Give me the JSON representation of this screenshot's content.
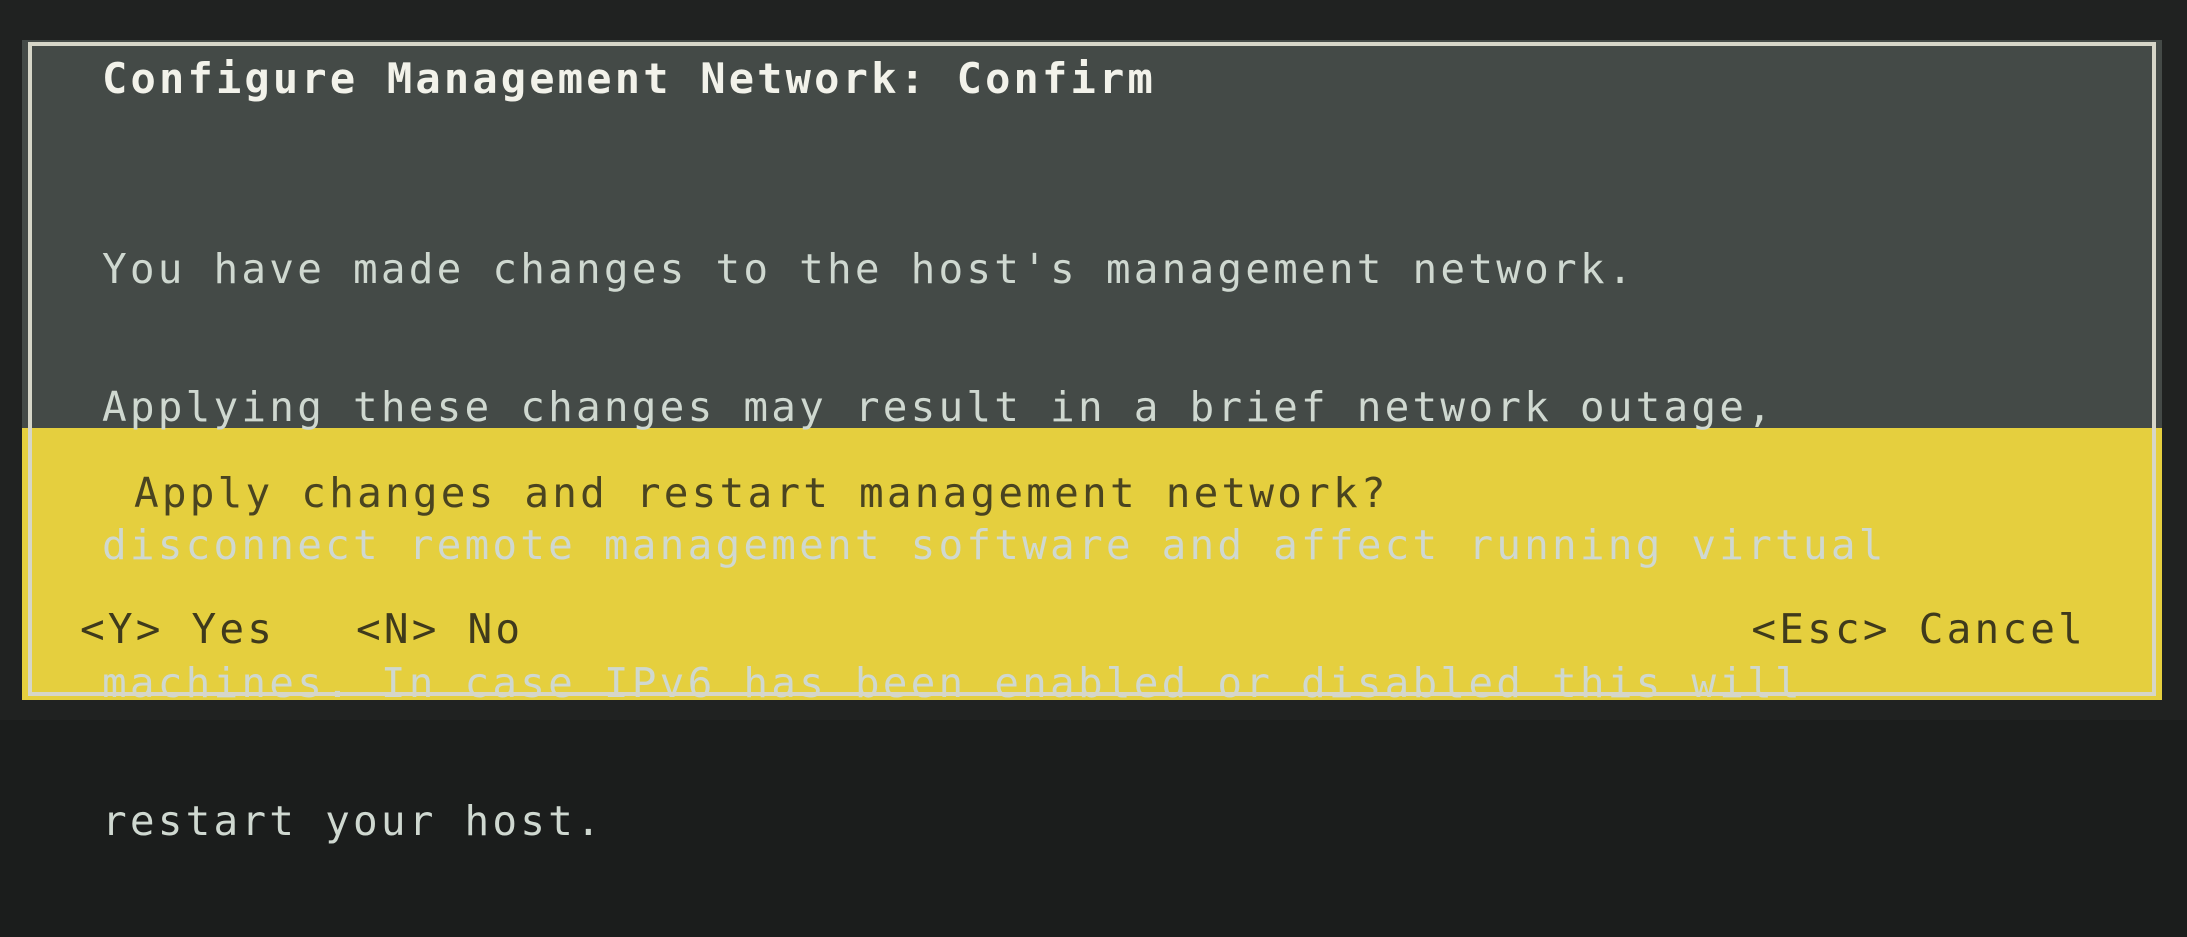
{
  "dialog": {
    "title": "Configure Management Network: Confirm",
    "message_lines": [
      "You have made changes to the host's management network.",
      "Applying these changes may result in a brief network outage,",
      "disconnect remote management software and affect running virtual",
      "machines. In case IPv6 has been enabled or disabled this will",
      "restart your host."
    ],
    "question": "Apply changes and restart management network?",
    "options": {
      "yes": "<Y> Yes",
      "no": "<N> No",
      "cancel": "<Esc> Cancel"
    }
  },
  "colors": {
    "header_bg": "#444a47",
    "prompt_bg": "#e5cf3e",
    "border": "#d6d6c8",
    "title_text": "#f2f2ea",
    "message_text": "#cfd8d0",
    "prompt_text": "#4a4420"
  }
}
